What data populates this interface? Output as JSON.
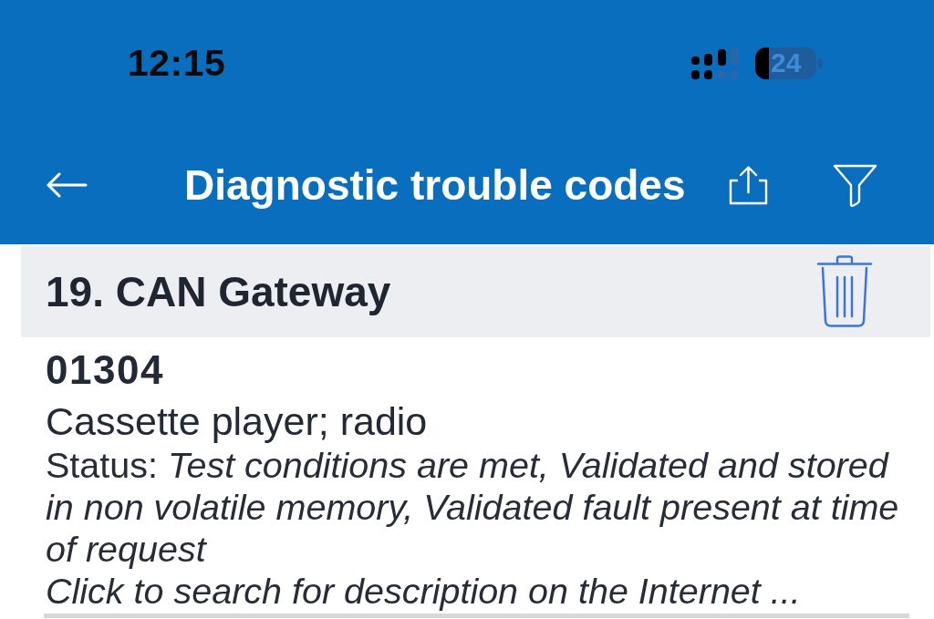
{
  "status_bar": {
    "time": "12:15",
    "battery": "24"
  },
  "nav_bar": {
    "title": "Diagnostic trouble codes"
  },
  "section": {
    "title": "19. CAN Gateway"
  },
  "trouble_codes": [
    {
      "code": "01304",
      "description": "Cassette player; radio",
      "status": "Status: *Test conditions are met, Validated and stored in non volatile memory, Validated fault present at time of request*",
      "link": "Click to search for description on the Internet ..."
    }
  ]
}
